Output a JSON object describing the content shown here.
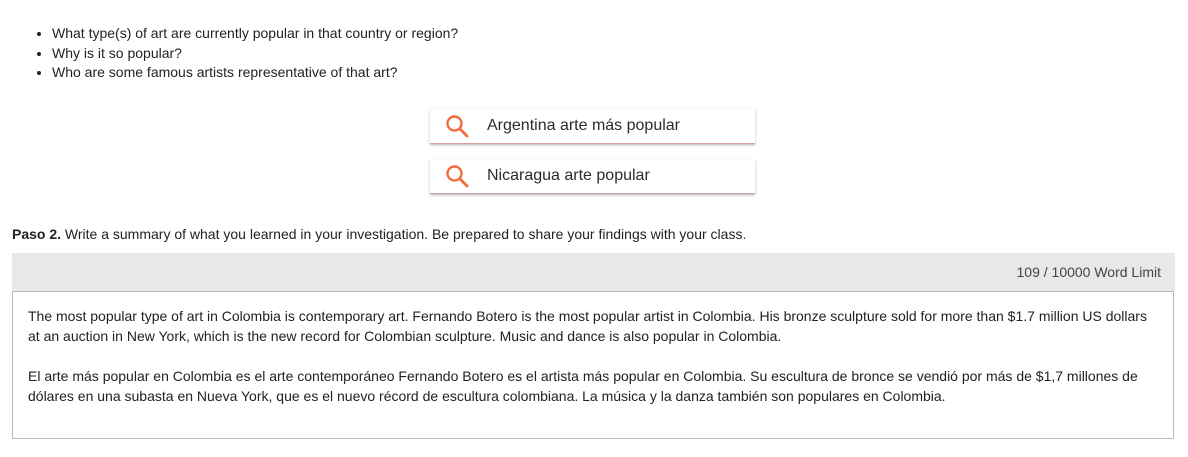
{
  "questions": [
    "What type(s) of art are currently popular in that country or region?",
    "Why is it so popular?",
    "Who are some famous artists representative of that art?"
  ],
  "search_chips": [
    {
      "label": "Argentina arte más popular",
      "icon": "search-icon"
    },
    {
      "label": "Nicaragua arte popular",
      "icon": "search-icon"
    }
  ],
  "colors": {
    "search_icon": "#f26b3a",
    "counter_bar_bg": "#e8e8e8"
  },
  "paso": {
    "label": "Paso 2.",
    "instruction": " Write a summary of what you learned in your investigation. Be prepared to share your findings with your class."
  },
  "counter": {
    "text": "109 /  10000 Word Limit"
  },
  "answer": {
    "paragraph_1": "The most popular type of art in Colombia is contemporary art. Fernando Botero is the most popular artist in Colombia. His bronze sculpture sold for more than $1.7 million US dollars at an auction in New York, which is the new record for Colombian sculpture. Music and dance is also popular in Colombia.",
    "paragraph_2": "El arte más popular en Colombia es el arte contemporáneo Fernando Botero es el artista más popular en Colombia. Su escultura de bronce se vendió por más de $1,7 millones de dólares en una subasta en Nueva York, que es el nuevo récord de escultura colombiana. La música y la danza también son populares en Colombia."
  }
}
